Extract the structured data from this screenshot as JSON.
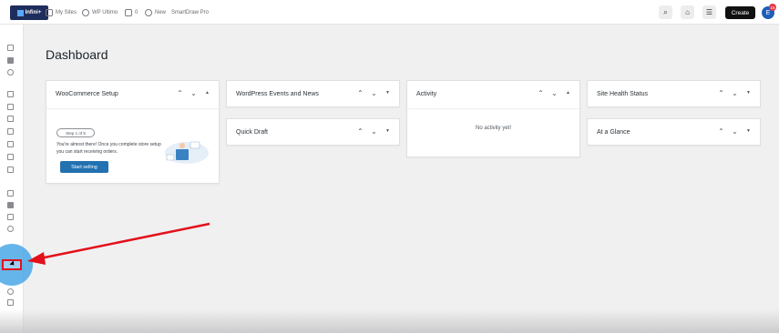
{
  "topbar": {
    "logo_text": "Infini+",
    "my_sites": "My Sites",
    "site_name": "WP Ultimo",
    "comments_count": "0",
    "new_label": "New",
    "smartdraw": "SmartDraw Pro",
    "create_label": "Create",
    "avatar_initial": "E",
    "notification_count": "15"
  },
  "main": {
    "title": "Dashboard"
  },
  "cards": {
    "woocommerce": {
      "title": "WooCommerce Setup",
      "step": "Step 1 of 5",
      "description": "You're almost there! Once you complete store setup you can start receiving orders.",
      "button": "Start selling"
    },
    "wp_events": {
      "title": "WordPress Events and News"
    },
    "quick_draft": {
      "title": "Quick Draft"
    },
    "activity": {
      "title": "Activity",
      "empty": "No activity yet!"
    },
    "site_health": {
      "title": "Site Health Status"
    },
    "at_a_glance": {
      "title": "At a Glance"
    }
  },
  "icons": {
    "ctrl_up": "chevron-up-icon",
    "ctrl_down": "chevron-down-icon",
    "ctrl_toggle": "triangle-toggle-icon"
  },
  "colors": {
    "accent": "#2271b1",
    "highlight": "#4aa8e6",
    "annotation": "#e3101b"
  }
}
